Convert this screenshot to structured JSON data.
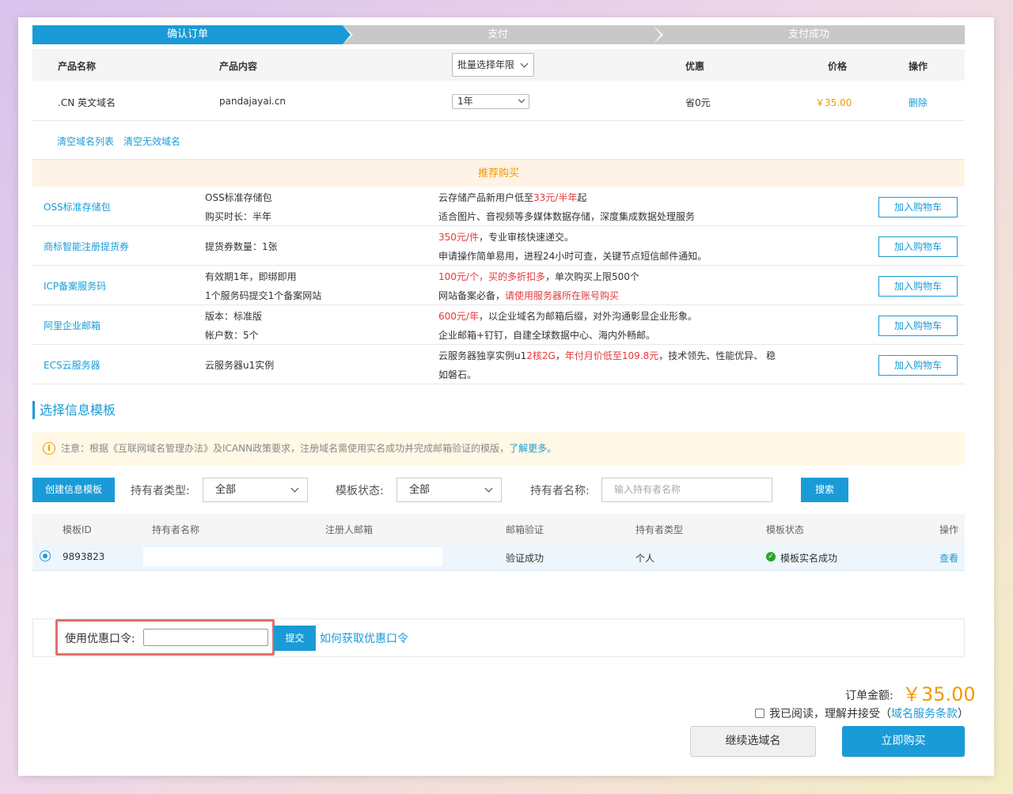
{
  "steps": [
    "确认订单",
    "支付",
    "支付成功"
  ],
  "product_table": {
    "headers": [
      "产品名称",
      "产品内容",
      "优惠",
      "价格",
      "操作"
    ],
    "bulk_select": "批量选择年限",
    "row": {
      "name": ".CN 英文域名",
      "content": "pandajayai.cn",
      "period": "1年",
      "discount": "省0元",
      "price": "￥35.00",
      "action": "删除"
    }
  },
  "list_actions": [
    "清空域名列表",
    "清空无效域名"
  ],
  "recommend": {
    "title": "推荐购买",
    "button_label": "加入购物车",
    "items": [
      {
        "name": "OSS标准存储包",
        "c1": [
          "OSS标准存储包",
          "购买时长：半年"
        ],
        "c2a": [
          "云存储产品新用户低至",
          "33元/半年",
          "起"
        ],
        "c2b": "适合图片、音视频等多媒体数据存储，深度集成数据处理服务"
      },
      {
        "name": "商标智能注册提货券",
        "c1": [
          "提货券数量：1张"
        ],
        "c2a": [
          "",
          "350元/件",
          "，专业审核快速递交。"
        ],
        "c2b": "申请操作简单易用，进程24小时可查，关键节点短信邮件通知。"
      },
      {
        "name": "ICP备案服务码",
        "c1": [
          "有效期1年，即绑即用",
          "1个服务码提交1个备案网站"
        ],
        "c2a": [
          "",
          "100元/个，买的多折扣多",
          "，单次购买上限500个"
        ],
        "c2b_pre": "网站备案必备，",
        "c2b_red": "请使用服务器所在账号购买"
      },
      {
        "name": "阿里企业邮箱",
        "c1": [
          "版本：标准版",
          "帐户数：5个"
        ],
        "c2a": [
          "",
          "600元/年",
          "，以企业域名为邮箱后缀，对外沟通彰显企业形象。"
        ],
        "c2b": "企业邮箱+钉钉，自建全球数据中心、海内外畅邮。"
      },
      {
        "name": "ECS云服务器",
        "c1": [
          "云服务器u1实例"
        ],
        "c2_parts": [
          "云服务器独享实例u1",
          "2核2G",
          "，",
          "年付月价低至109.8元",
          "，技术领先、性能优异、 稳"
        ],
        "c2b": "如磐石。"
      }
    ]
  },
  "template_section": {
    "title": "选择信息模板",
    "notice_icon": "info-icon",
    "notice": "注意：根据《互联网域名管理办法》及ICANN政策要求，注册域名需使用实名成功并完成邮箱验证的模版，",
    "notice_link": "了解更多。",
    "create_button": "创建信息模板",
    "filters": {
      "holder_type_label": "持有者类型:",
      "holder_type_value": "全部",
      "status_label": "模板状态:",
      "status_value": "全部",
      "holder_name_label": "持有者名称:",
      "holder_name_placeholder": "输入持有者名称",
      "search_button": "搜索"
    },
    "table_headers": [
      "模板ID",
      "持有者名称",
      "注册人邮箱",
      "邮箱验证",
      "持有者类型",
      "模板状态",
      "操作"
    ],
    "row": {
      "id": "9893823",
      "email_verify": "验证成功",
      "holder_type": "个人",
      "status": "模板实名成功",
      "action": "查看"
    }
  },
  "coupon": {
    "label": "使用优惠口令:",
    "submit": "提交",
    "help_link": "如何获取优惠口令"
  },
  "footer": {
    "total_label": "订单金额:",
    "total_value": "￥35.00",
    "agree_text": "我已阅读，理解并接受",
    "terms_link": "域名服务条款",
    "continue_button": "继续选域名",
    "buy_button": "立即购买"
  },
  "colors": {
    "accent": "#1a9bd7",
    "price": "#f39800",
    "highlight": "#e4393c"
  }
}
